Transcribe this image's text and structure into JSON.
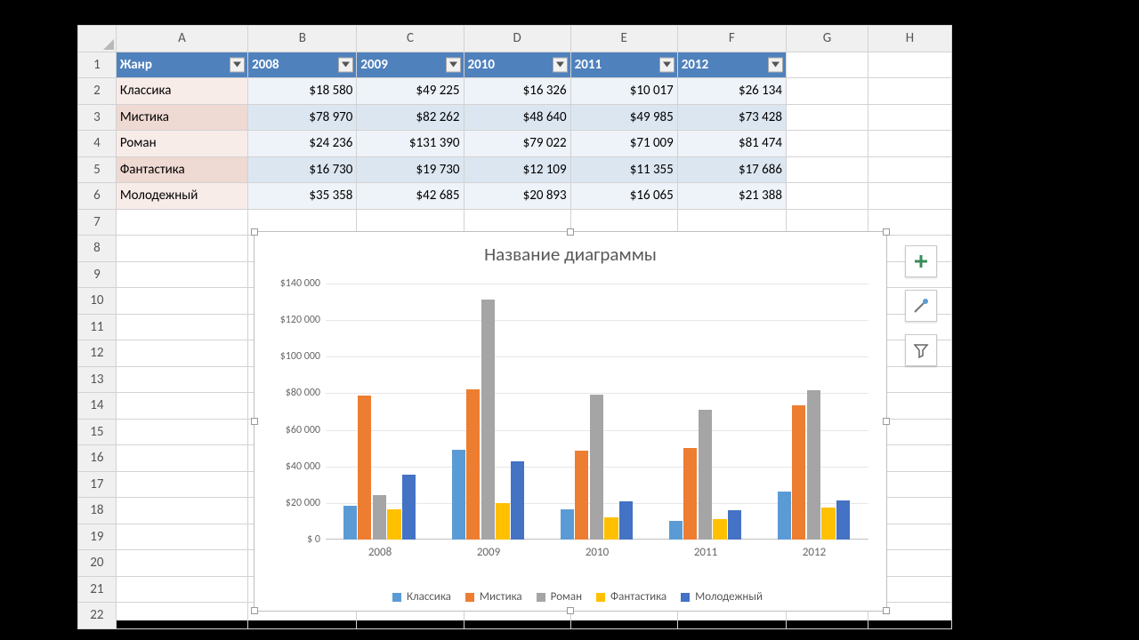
{
  "columns": [
    "A",
    "B",
    "C",
    "D",
    "E",
    "F",
    "G",
    "H"
  ],
  "rows": [
    "1",
    "2",
    "3",
    "4",
    "5",
    "6",
    "7",
    "8",
    "9",
    "10",
    "11",
    "12",
    "13",
    "14",
    "15",
    "16",
    "17",
    "18",
    "19",
    "20",
    "21",
    "22"
  ],
  "headers": {
    "genre": "Жанр",
    "y2008": "2008",
    "y2009": "2009",
    "y2010": "2010",
    "y2011": "2011",
    "y2012": "2012"
  },
  "table_rows": [
    {
      "genre": "Классика",
      "y2008": "$18 580",
      "y2009": "$49 225",
      "y2010": "$16 326",
      "y2011": "$10 017",
      "y2012": "$26 134"
    },
    {
      "genre": "Мистика",
      "y2008": "$78 970",
      "y2009": "$82 262",
      "y2010": "$48 640",
      "y2011": "$49 985",
      "y2012": "$73 428"
    },
    {
      "genre": "Роман",
      "y2008": "$24 236",
      "y2009": "$131 390",
      "y2010": "$79 022",
      "y2011": "$71 009",
      "y2012": "$81 474"
    },
    {
      "genre": "Фантастика",
      "y2008": "$16 730",
      "y2009": "$19 730",
      "y2010": "$12 109",
      "y2011": "$11 355",
      "y2012": "$17 686"
    },
    {
      "genre": "Молодежный",
      "y2008": "$35 358",
      "y2009": "$42 685",
      "y2010": "$20 893",
      "y2011": "$16 065",
      "y2012": "$21 388"
    }
  ],
  "chart_title": "Название диаграммы",
  "chart_data": {
    "type": "bar",
    "title": "Название диаграммы",
    "xlabel": "",
    "ylabel": "",
    "categories": [
      "2008",
      "2009",
      "2010",
      "2011",
      "2012"
    ],
    "ylim": [
      0,
      140000
    ],
    "yticks": [
      0,
      20000,
      40000,
      60000,
      80000,
      100000,
      120000,
      140000
    ],
    "ytick_labels": [
      "$ 0",
      "$20 000",
      "$40 000",
      "$60 000",
      "$80 000",
      "$100 000",
      "$120 000",
      "$140 000"
    ],
    "series": [
      {
        "name": "Классика",
        "color": "#5b9bd5",
        "values": [
          18580,
          49225,
          16326,
          10017,
          26134
        ]
      },
      {
        "name": "Мистика",
        "color": "#ed7d31",
        "values": [
          78970,
          82262,
          48640,
          49985,
          73428
        ]
      },
      {
        "name": "Роман",
        "color": "#a5a5a5",
        "values": [
          24236,
          131390,
          79022,
          71009,
          81474
        ]
      },
      {
        "name": "Фантастика",
        "color": "#ffc000",
        "values": [
          16730,
          19730,
          12109,
          11355,
          17686
        ]
      },
      {
        "name": "Молодежный",
        "color": "#4472c4",
        "values": [
          35358,
          42685,
          20893,
          16065,
          21388
        ]
      }
    ]
  },
  "side_buttons": [
    "plus",
    "paintbrush",
    "filter"
  ]
}
